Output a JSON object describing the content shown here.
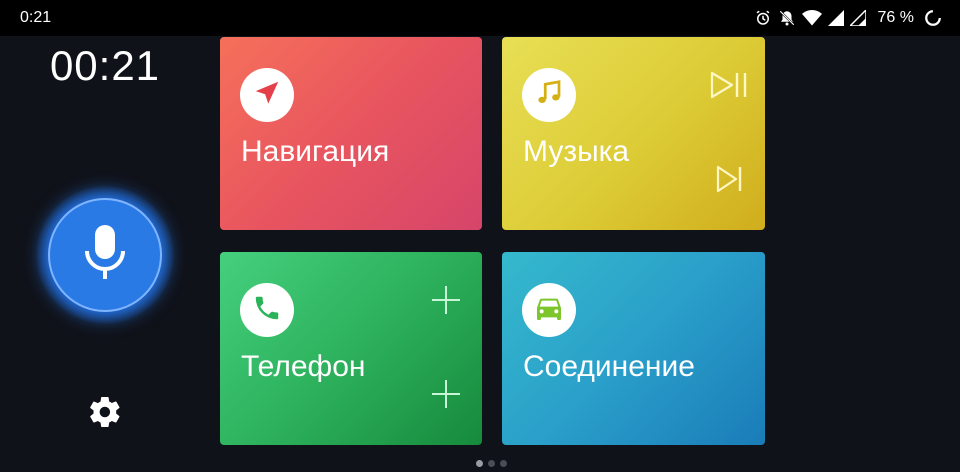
{
  "status_bar": {
    "time": "0:21",
    "battery_text": "76 %",
    "icons": [
      "alarm-icon",
      "notifications-off-icon",
      "wifi-icon",
      "signal-icon",
      "signal-icon",
      "battery-saver-icon"
    ]
  },
  "left_rail": {
    "clock": "00:21",
    "mic_icon": "microphone-icon",
    "settings_icon": "gear-icon"
  },
  "tiles": [
    {
      "label": "Навигация",
      "icon": "navigation-arrow-icon",
      "color": "#e8555f"
    },
    {
      "label": "Музыка",
      "icon": "music-note-icon",
      "color": "#dccb35",
      "actions": [
        "play-pause-icon",
        "skip-next-icon"
      ]
    },
    {
      "label": "Телефон",
      "icon": "phone-icon",
      "color": "#2db15c",
      "actions": [
        "plus-icon",
        "plus-icon"
      ]
    },
    {
      "label": "Соединение",
      "icon": "car-icon",
      "color": "#2a9fca"
    }
  ],
  "pager": {
    "pages": 3,
    "current": 1
  }
}
